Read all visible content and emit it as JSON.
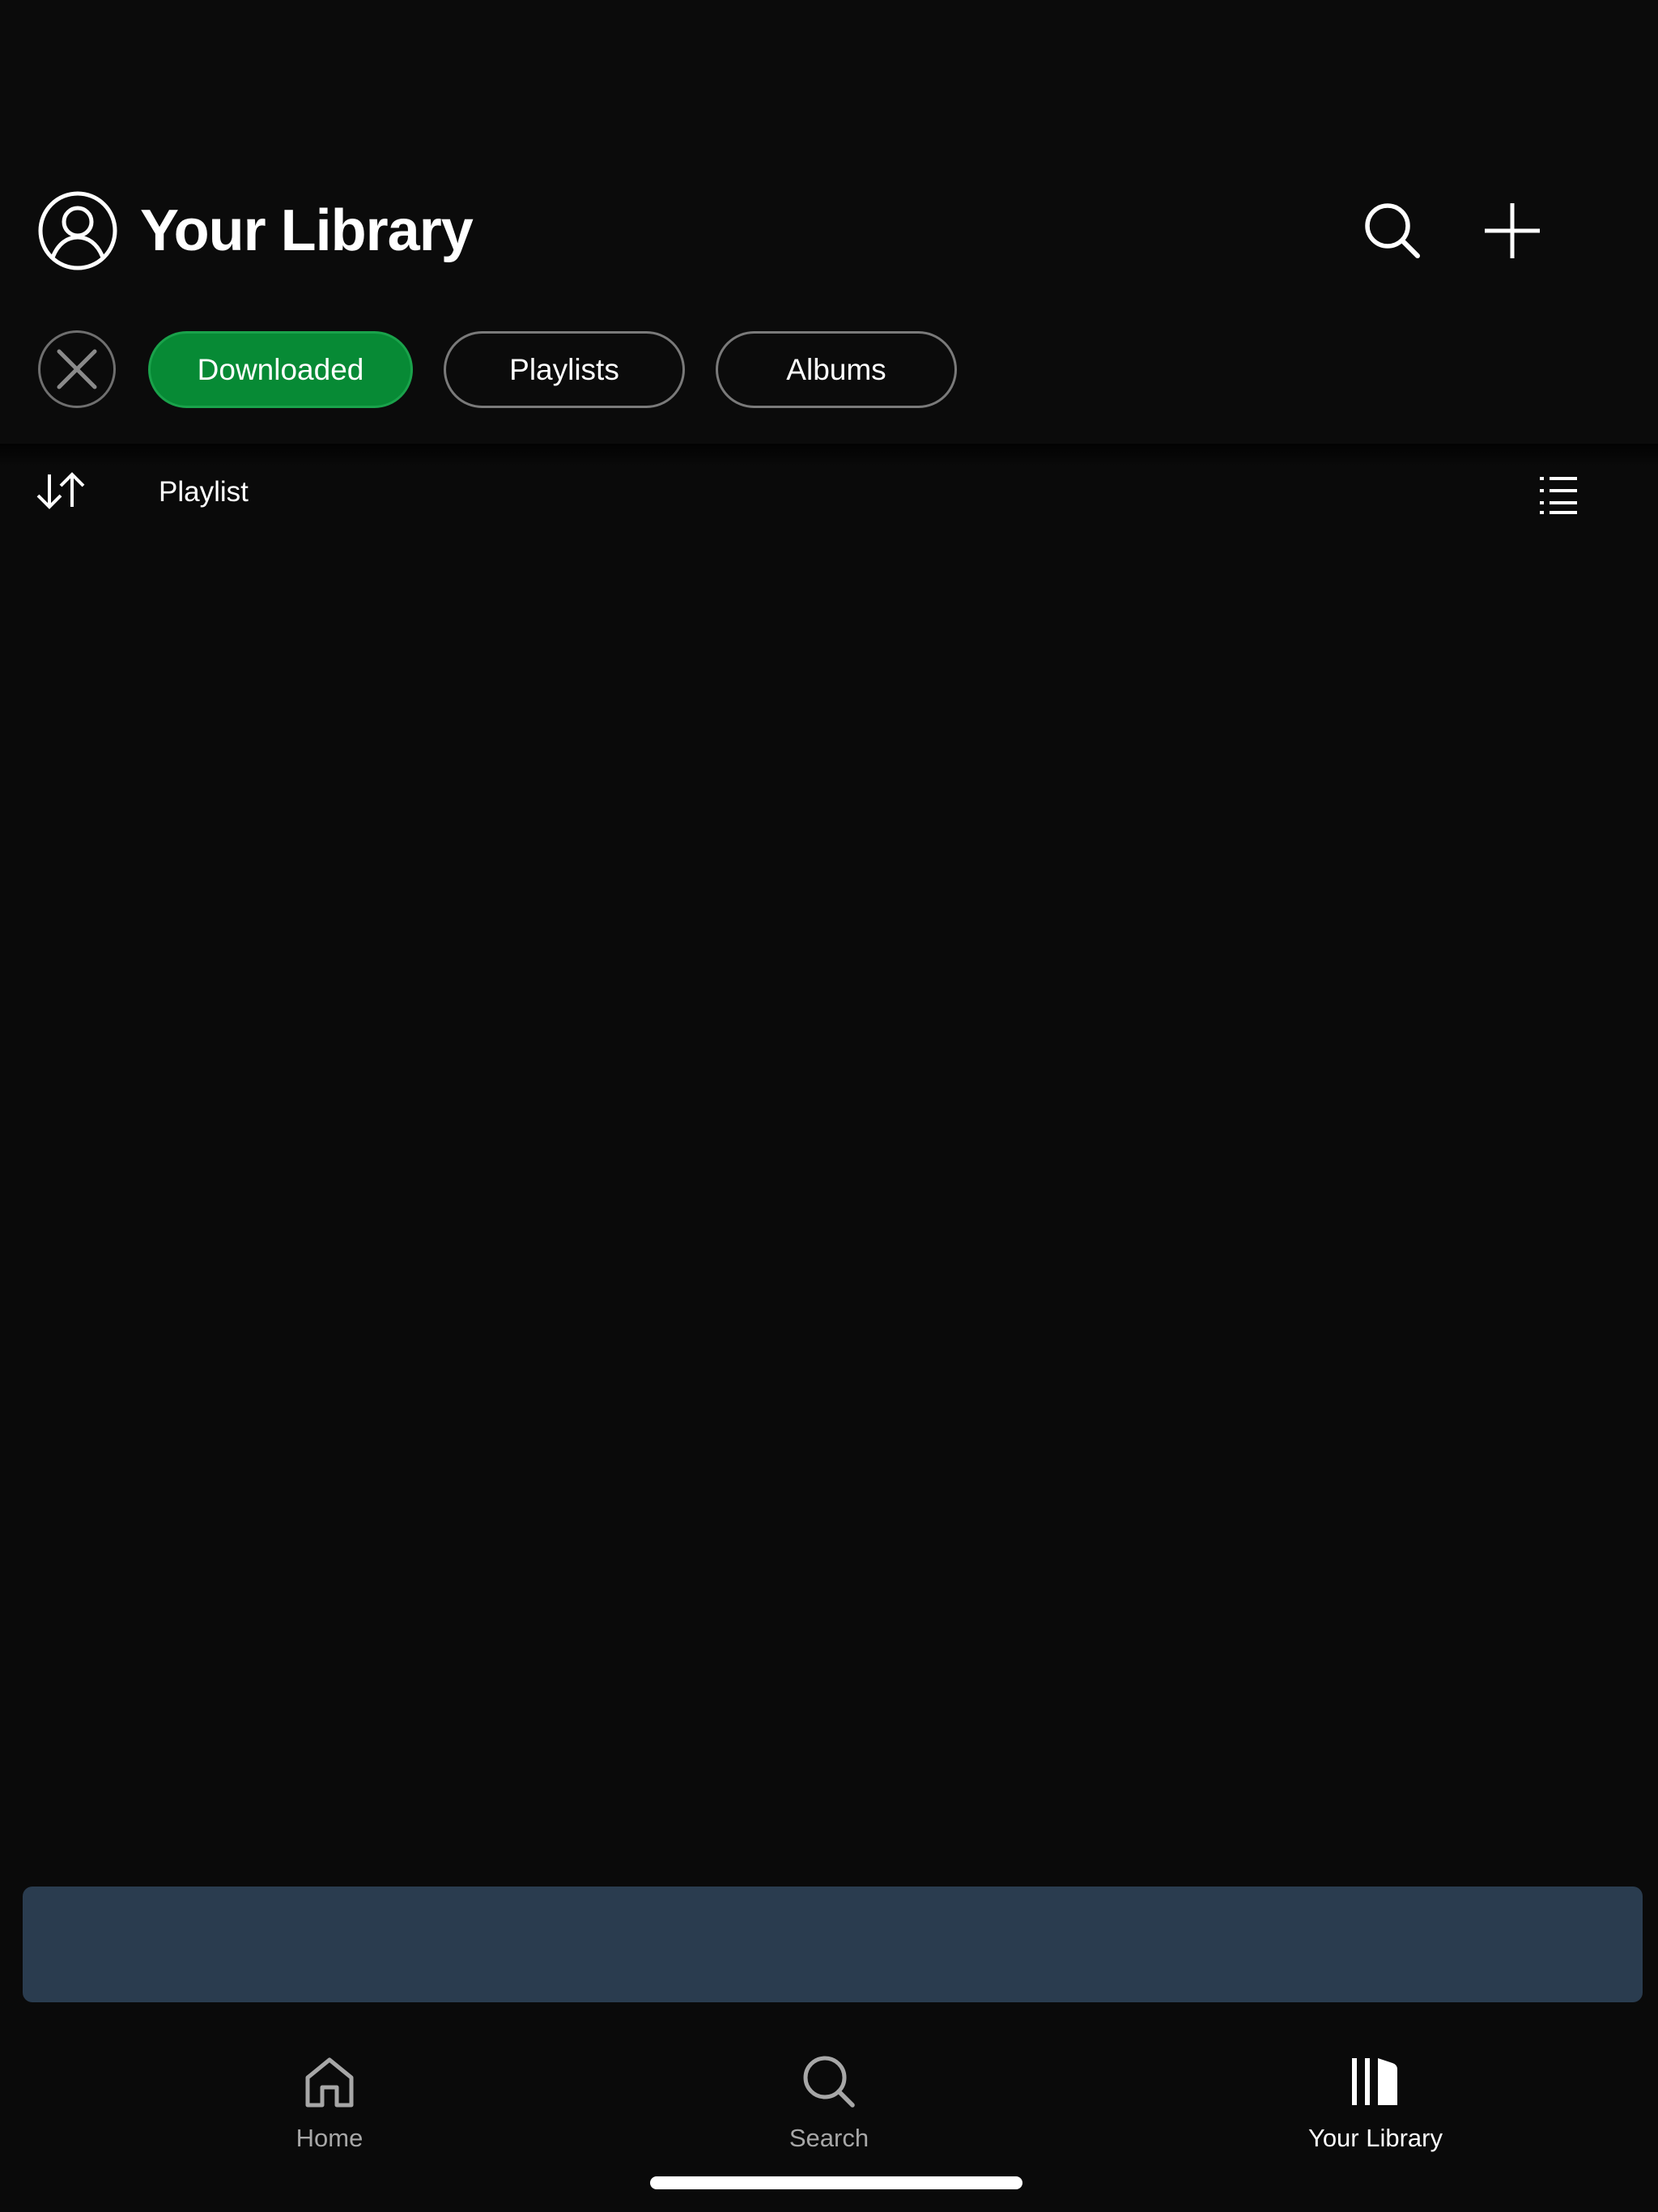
{
  "header": {
    "title": "Your Library",
    "avatar_icon": "user-circle-icon",
    "search_icon": "search-icon",
    "add_icon": "plus-icon"
  },
  "filters": {
    "clear_icon": "close-icon",
    "chips": [
      {
        "label": "Downloaded",
        "active": true
      },
      {
        "label": "Playlists",
        "active": false
      },
      {
        "label": "Albums",
        "active": false
      }
    ]
  },
  "sort": {
    "icon": "sort-arrows-icon",
    "label": "Playlist",
    "view_icon": "list-view-icon"
  },
  "tabbar": {
    "tabs": [
      {
        "label": "Home",
        "icon": "home-icon",
        "active": false
      },
      {
        "label": "Search",
        "icon": "search-icon",
        "active": false
      },
      {
        "label": "Your Library",
        "icon": "library-icon",
        "active": true
      }
    ]
  },
  "colors": {
    "background": "#0a0a0a",
    "accent_green": "#078a35",
    "banner": "#2a3c4f",
    "inactive_text": "#a7a7a7"
  }
}
